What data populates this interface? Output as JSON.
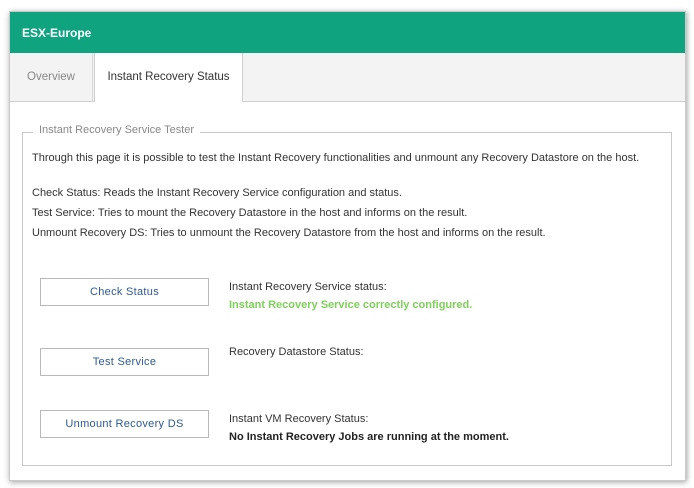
{
  "window": {
    "title": "ESX-Europe"
  },
  "tabs": [
    {
      "label": "Overview",
      "active": false
    },
    {
      "label": "Instant Recovery Status",
      "active": true
    }
  ],
  "tester": {
    "legend": "Instant Recovery Service Tester",
    "intro": "Through this page it is possible to test the Instant Recovery functionalities and unmount any Recovery Datastore on the host.",
    "descriptions": [
      "Check Status: Reads the Instant Recovery Service configuration and status.",
      "Test Service: Tries to mount the Recovery Datastore in the host and informs on the result.",
      "Unmount Recovery DS: Tries to unmount the Recovery Datastore from the host and informs on the result."
    ],
    "actions": [
      {
        "button": "Check Status",
        "status_label": "Instant Recovery Service status:",
        "status_value": "Instant Recovery Service correctly configured."
      },
      {
        "button": "Test Service",
        "status_label": "Recovery Datastore Status:",
        "status_value": ""
      },
      {
        "button": "Unmount Recovery DS",
        "status_label": "Instant VM Recovery Status:",
        "status_value": "No Instant Recovery Jobs are running at the moment."
      }
    ]
  },
  "colors": {
    "header": "#10a37f",
    "success": "#7ed05a",
    "button_text": "#2d5b8c"
  }
}
